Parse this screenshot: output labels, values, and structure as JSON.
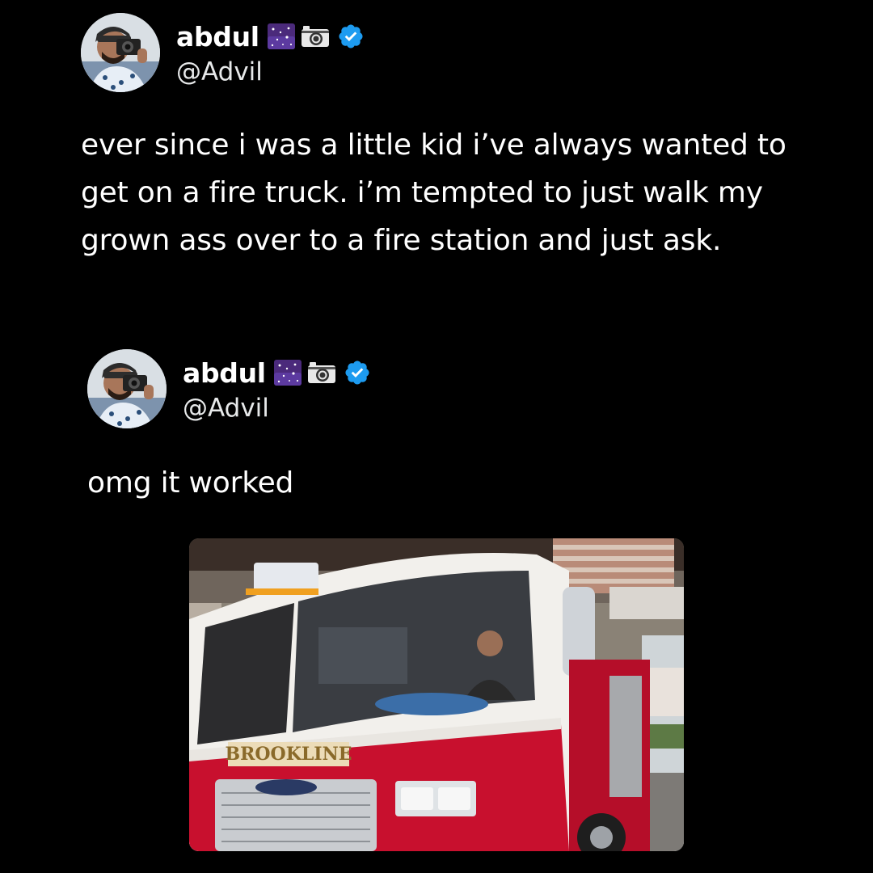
{
  "tweets": [
    {
      "display_name": "abdul",
      "handle": "@Advil",
      "badges": [
        "sparkles-emoji",
        "camera-emoji",
        "verified-badge"
      ],
      "text": "ever since i was a little kid i’ve always wanted to get on a fire truck. i’m tempted to just walk my grown ass over to a fire station and just ask."
    },
    {
      "display_name": "abdul",
      "handle": "@Advil",
      "badges": [
        "sparkles-emoji",
        "camera-emoji",
        "verified-badge"
      ],
      "text": "omg it worked",
      "media": {
        "description": "photo of a man sitting in the driver seat of a red and white fire truck inside a fire station",
        "truck_label": "BROOKLINE"
      }
    }
  ],
  "colors": {
    "background": "#000000",
    "text": "#ffffff",
    "verified": "#1d9bf0",
    "truck_red": "#c8102e"
  }
}
